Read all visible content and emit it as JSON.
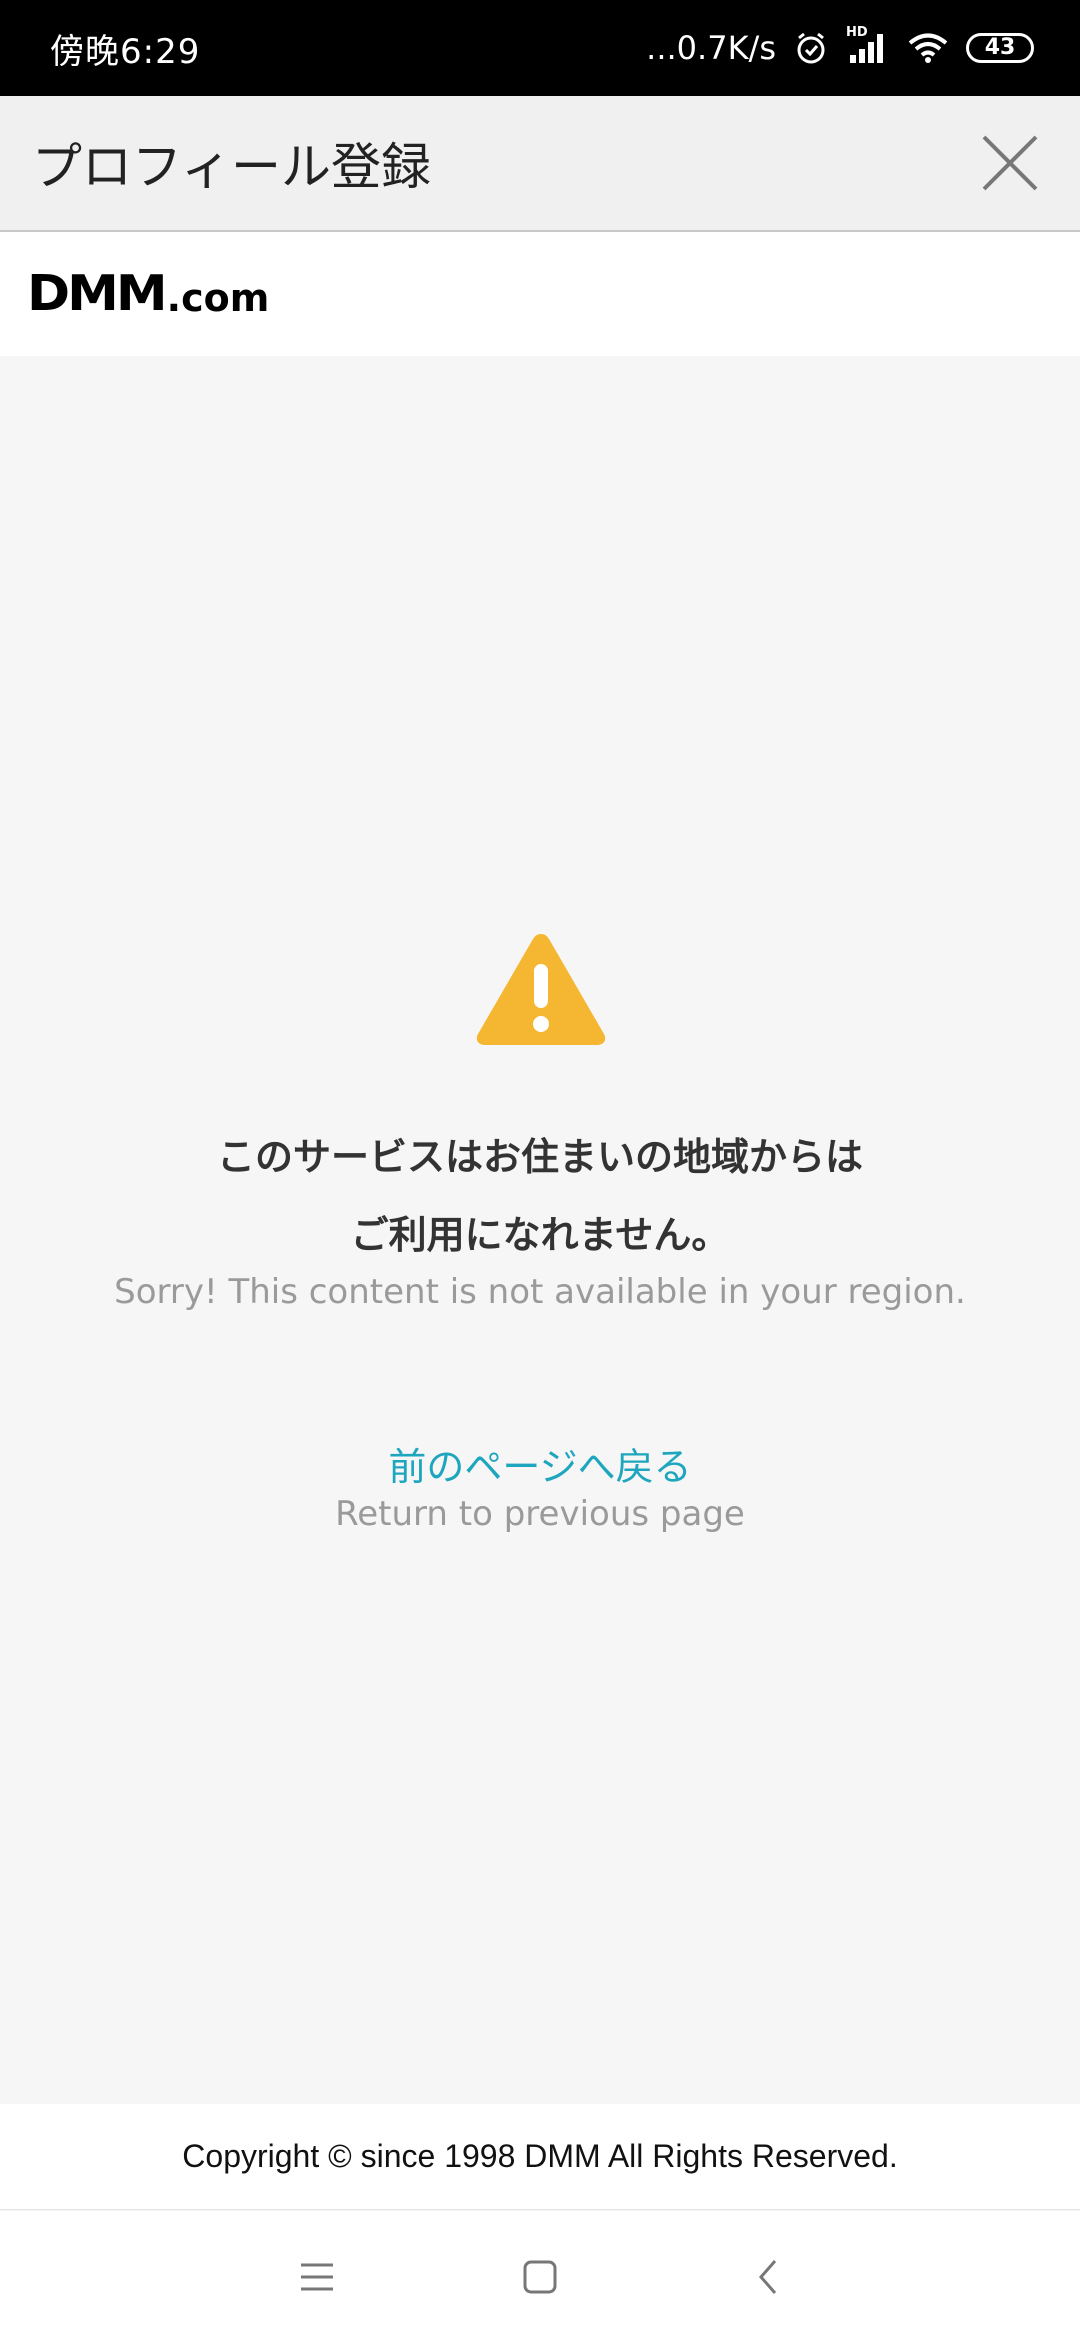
{
  "status_bar": {
    "time": "傍晚6:29",
    "network_speed": "...0.7K/s",
    "signal_label": "HD",
    "battery": "43"
  },
  "title_bar": {
    "title": "プロフィール登録"
  },
  "logo": {
    "main": "DMM",
    "suffix": ".com"
  },
  "message": {
    "line1": "このサービスはお住まいの地域からは",
    "line2": "ご利用になれません。",
    "english": "Sorry! This content is not available in your region."
  },
  "back": {
    "label": "前のページへ戻る",
    "english": "Return to previous page"
  },
  "footer": {
    "copyright": "Copyright © since 1998 DMM All Rights Reserved."
  },
  "colors": {
    "warning": "#f5b731",
    "link": "#1fa6bf"
  }
}
